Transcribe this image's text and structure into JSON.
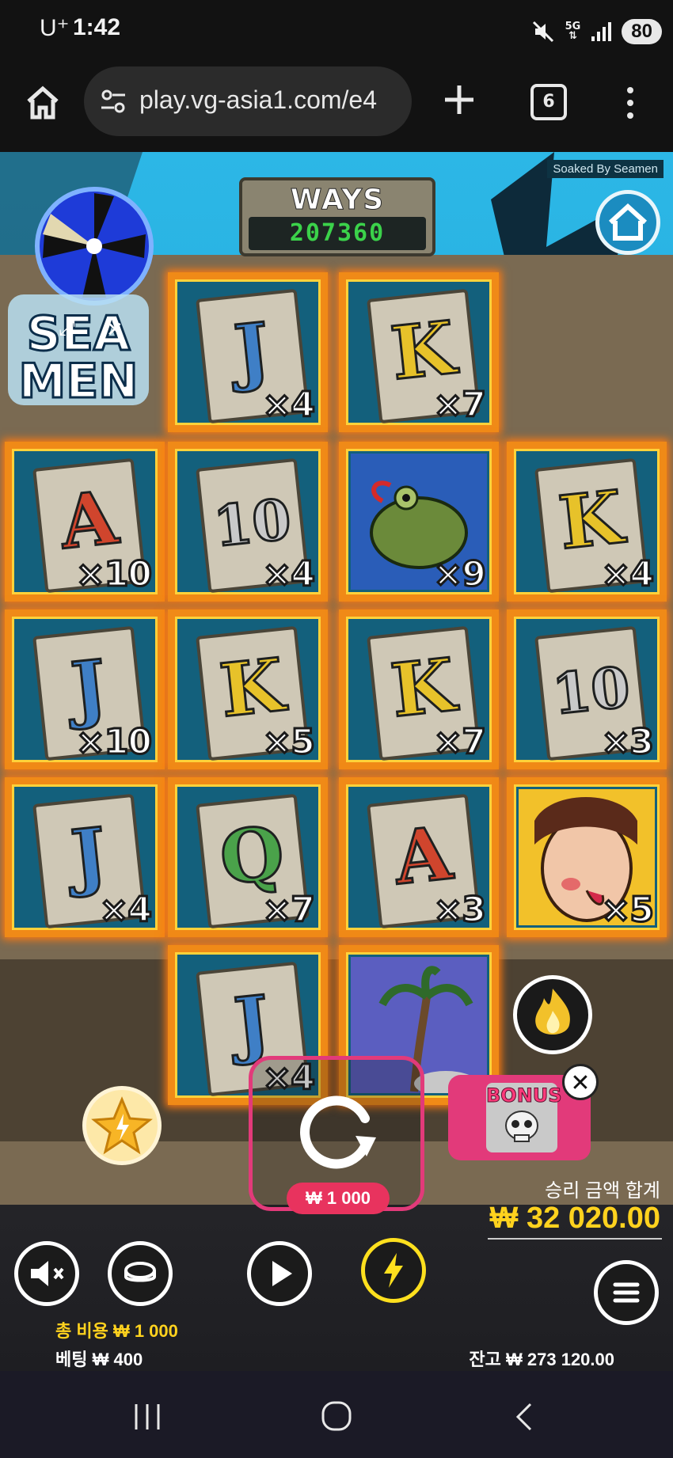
{
  "status_bar": {
    "carrier": "U⁺",
    "time": "1:42",
    "network": "5G",
    "battery": "80"
  },
  "browser": {
    "url": "play.vg-asia1.com/e4",
    "tab_count": "6"
  },
  "game": {
    "title_tag": "Soaked By Seamen",
    "ways_label": "WAYS",
    "ways_value": "207360",
    "grid": [
      {
        "symbol": "J",
        "mult": "×4",
        "color": "#3f7fc6"
      },
      {
        "symbol": "K",
        "mult": "×7",
        "color": "#e7c22a"
      },
      {
        "symbol": "A",
        "mult": "×10",
        "color": "#d0452d"
      },
      {
        "symbol": "10",
        "mult": "×4",
        "color": "#c9c9c9"
      },
      {
        "symbol": "frog",
        "mult": "×9",
        "color": "#6b8a3a"
      },
      {
        "symbol": "K",
        "mult": "×4",
        "color": "#e7c22a"
      },
      {
        "symbol": "J",
        "mult": "×10",
        "color": "#3f7fc6"
      },
      {
        "symbol": "K",
        "mult": "×5",
        "color": "#e7c22a"
      },
      {
        "symbol": "K",
        "mult": "×7",
        "color": "#e7c22a"
      },
      {
        "symbol": "10",
        "mult": "×3",
        "color": "#c9c9c9"
      },
      {
        "symbol": "J",
        "mult": "×4",
        "color": "#3f7fc6"
      },
      {
        "symbol": "Q",
        "mult": "×7",
        "color": "#4aa24a"
      },
      {
        "symbol": "A",
        "mult": "×3",
        "color": "#d0452d"
      },
      {
        "symbol": "lady",
        "mult": "×5",
        "color": "#f2c12a"
      },
      {
        "symbol": "J",
        "mult": "×4",
        "color": "#3f7fc6"
      },
      {
        "symbol": "palm",
        "mult": "",
        "color": "#5b5ec0"
      }
    ],
    "spin_cost": "₩ 1 000",
    "bonus_label": "BONUS",
    "win_label": "승리 금액 합계",
    "win_amount": "₩ 32 020.00",
    "total_cost": "총 비용  ₩ 1 000",
    "bet": "베팅  ₩ 400",
    "balance": "잔고  ₩ 273 120.00"
  },
  "icons": [
    "home-icon",
    "tune-icon",
    "plus-icon",
    "tabs-icon",
    "more-icon",
    "mute-icon",
    "coin-icon",
    "play-icon",
    "lightning-icon",
    "menu-icon",
    "star-icon",
    "flame-icon",
    "close-icon",
    "spin-icon",
    "recent-apps-icon",
    "nav-home-icon",
    "back-icon"
  ]
}
